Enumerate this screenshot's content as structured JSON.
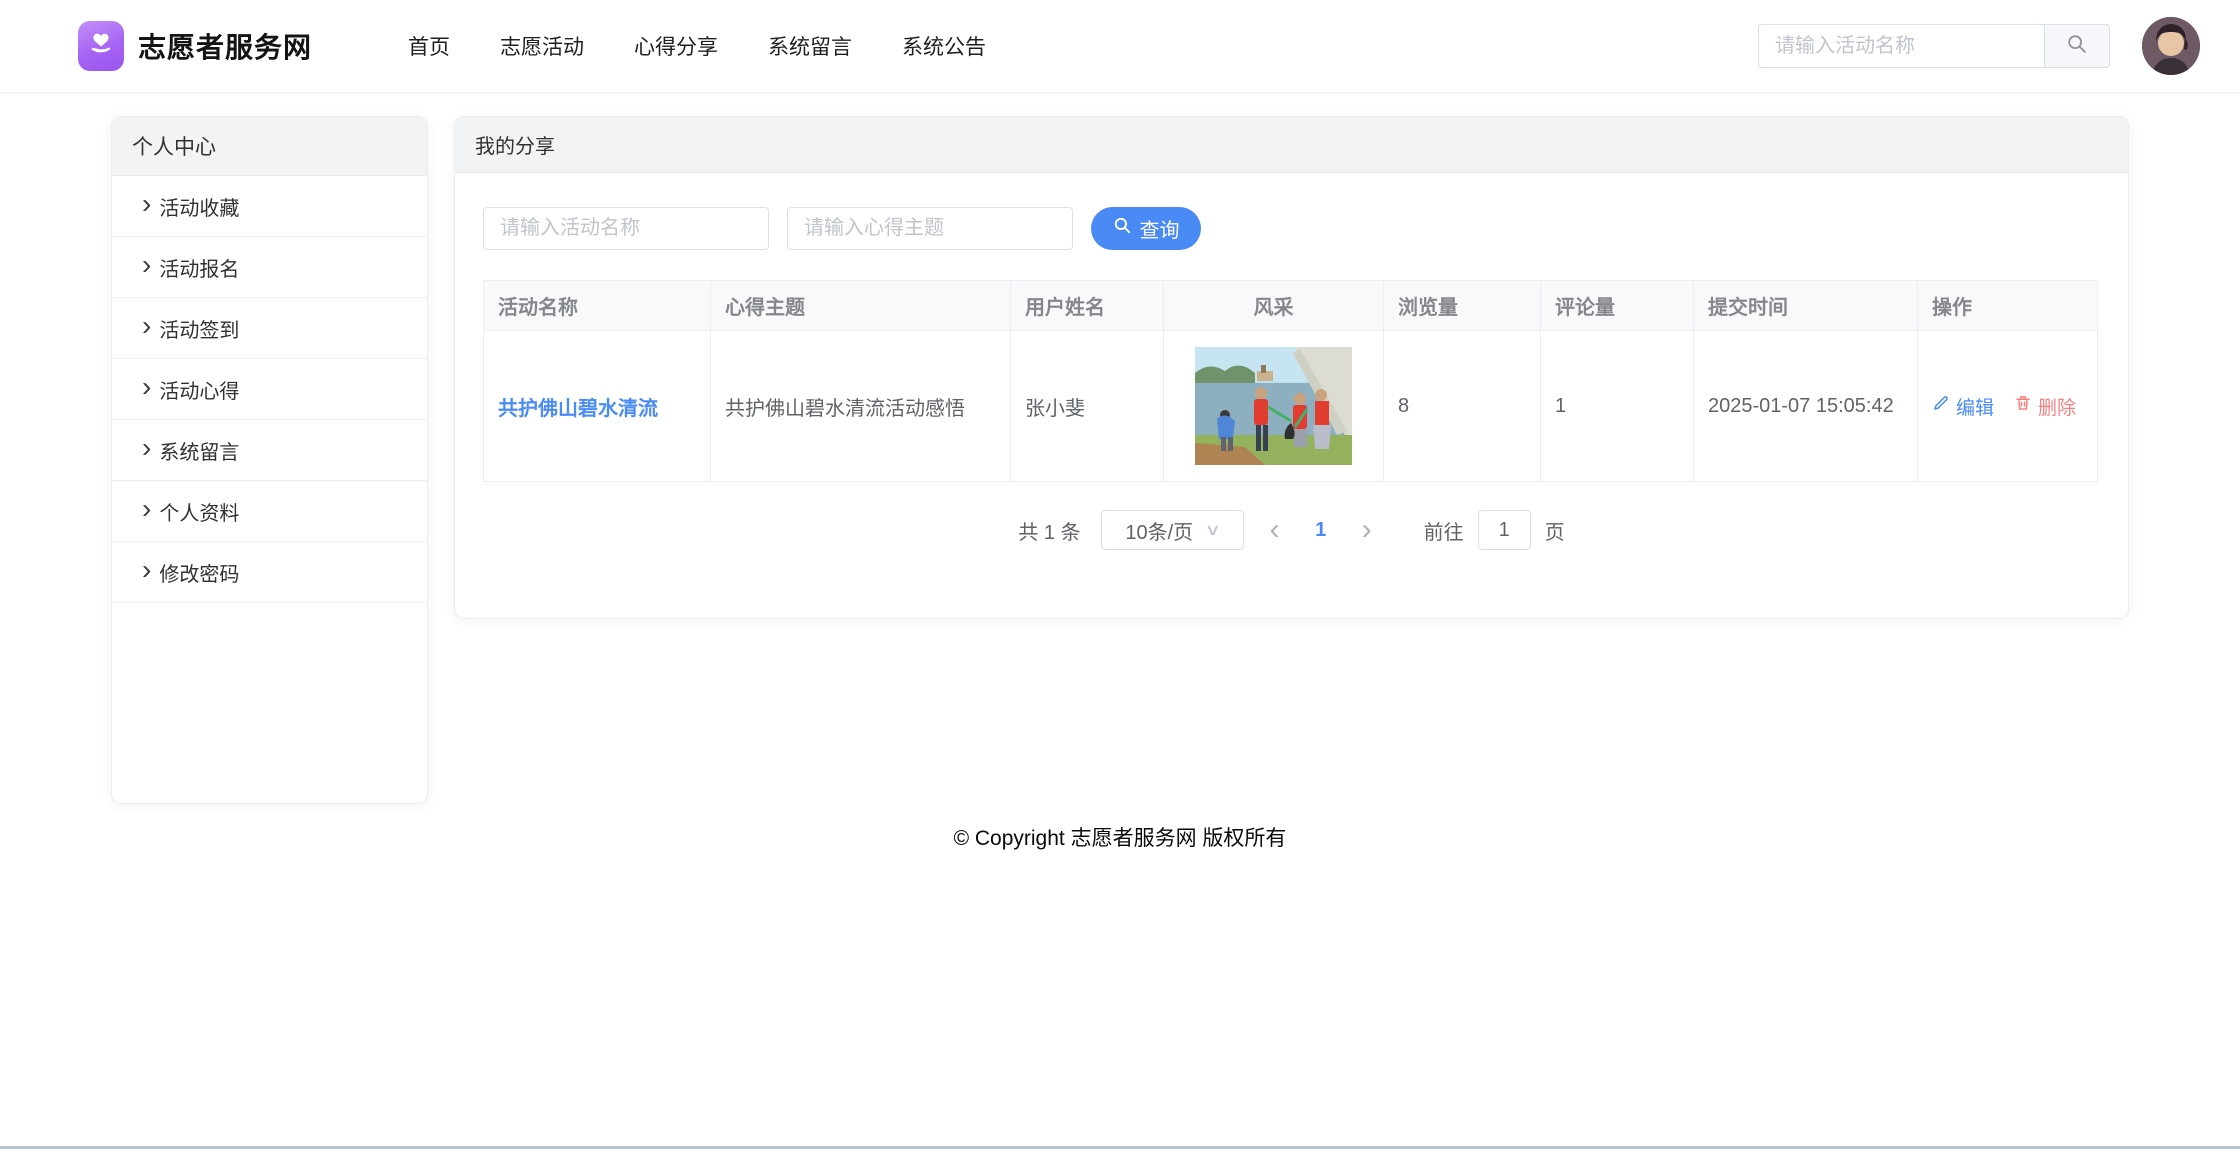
{
  "header": {
    "brand": "志愿者服务网",
    "nav": [
      "首页",
      "志愿活动",
      "心得分享",
      "系统留言",
      "系统公告"
    ],
    "search_placeholder": "请输入活动名称"
  },
  "sidebar": {
    "title": "个人中心",
    "items": [
      "活动收藏",
      "活动报名",
      "活动签到",
      "活动心得",
      "系统留言",
      "个人资料",
      "修改密码"
    ]
  },
  "main": {
    "title": "我的分享",
    "filters": {
      "activity_placeholder": "请输入活动名称",
      "topic_placeholder": "请输入心得主题",
      "query_label": "查询"
    },
    "table": {
      "columns": [
        "活动名称",
        "心得主题",
        "用户姓名",
        "风采",
        "浏览量",
        "评论量",
        "提交时间",
        "操作"
      ],
      "rows": [
        {
          "activity_name": "共护佛山碧水清流",
          "topic": "共护佛山碧水清流活动感悟",
          "user_name": "张小斐",
          "photo_alt": "volunteers-cleaning-lakeside-photo",
          "views": "8",
          "comments": "1",
          "submit_time": "2025-01-07 15:05:42",
          "edit_label": "编辑",
          "delete_label": "删除"
        }
      ]
    },
    "pagination": {
      "total": "共 1 条",
      "page_size": "10条/页",
      "current_page": "1",
      "goto_label": "前往",
      "goto_value": "1",
      "page_unit": "页"
    }
  },
  "footer": {
    "copyright": "© Copyright 志愿者服务网 版权所有"
  },
  "colors": {
    "primary_blue": "#4a8af4",
    "link_blue": "#4a8cf5",
    "danger_red": "#f58080",
    "brand_purple": "#a763f3",
    "header_strip_gray": "#f2f3f5",
    "table_border": "#ebeef5"
  }
}
